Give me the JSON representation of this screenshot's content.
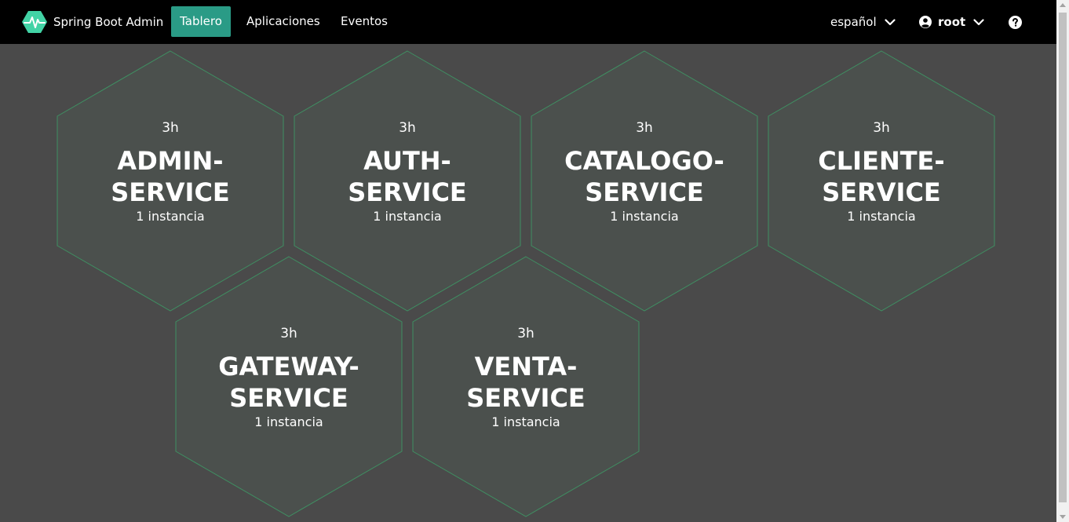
{
  "navbar": {
    "brand": "Spring Boot Admin",
    "items": [
      {
        "label": "Tablero",
        "active": true
      },
      {
        "label": "Aplicaciones",
        "active": false
      },
      {
        "label": "Eventos",
        "active": false
      }
    ],
    "language": "español",
    "user": "root",
    "icons": {
      "brand": "heartbeat-logo-icon",
      "language_toggle": "chevron-down-icon",
      "user": "user-circle-icon",
      "user_toggle": "chevron-down-icon",
      "help": "question-circle-icon"
    }
  },
  "applications": [
    {
      "uptime": "3h",
      "name_line1": "ADMIN-",
      "name_line2": "SERVICE",
      "instances": "1 instancia"
    },
    {
      "uptime": "3h",
      "name_line1": "AUTH-",
      "name_line2": "SERVICE",
      "instances": "1 instancia"
    },
    {
      "uptime": "3h",
      "name_line1": "CATALOGO-",
      "name_line2": "SERVICE",
      "instances": "1 instancia"
    },
    {
      "uptime": "3h",
      "name_line1": "CLIENTE-",
      "name_line2": "SERVICE",
      "instances": "1 instancia"
    },
    {
      "uptime": "3h",
      "name_line1": "GATEWAY-",
      "name_line2": "SERVICE",
      "instances": "1 instancia"
    },
    {
      "uptime": "3h",
      "name_line1": "VENTA-",
      "name_line2": "SERVICE",
      "instances": "1 instancia"
    }
  ],
  "colors": {
    "navbar_bg": "#000000",
    "active_tab": "#2a9b86",
    "page_bg": "#4a4a4a",
    "hex_fill": "#4b504d",
    "hex_stroke": "#3f8f62",
    "status_up": "#42d3a5"
  }
}
